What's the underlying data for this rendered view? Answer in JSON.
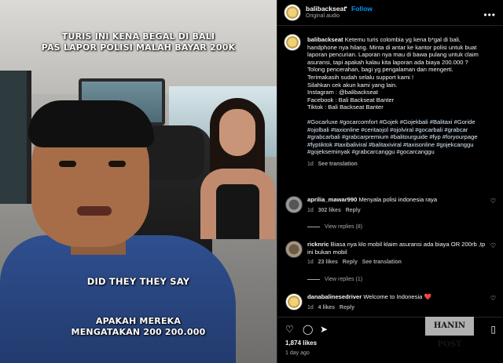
{
  "video": {
    "caption_top": "TURIS INI KENA BEGAL DI BALI\nPAS LAPOR POLISI MALAH BAYAR 200K",
    "caption_mid": "DID THEY THEY SAY",
    "caption_bottom": "APAKAH MEREKA\nMENGATAKAN 200 200.000"
  },
  "header": {
    "username": "balibackseat",
    "follow_label": "Follow",
    "audio": "Original audio",
    "more_icon": "more-horizontal-icon"
  },
  "post": {
    "username": "balibackseat",
    "lines": [
      "Ketemu turis colombia yg kena b*gal di bali,",
      "handphone nya hilang. Minta di antar ke kantor polisi untuk buat",
      "laporan pencurian. Laporan nya mau di bawa pulang untuk claim",
      "asuransi, tapi apakah kalau kita laporan ada biaya 200.000 ?",
      "Tolong pencerahan, bagi yg pengalaman dan mengerti.",
      "Terimakasih sudah selalu support kami !",
      "Silahkan cek akun kami yang lain.",
      "Instagram : @balibackseat",
      "Facebook : Bali Backseat Banter",
      "Tiktok : Bali Backseat Banter"
    ],
    "hashtags": "#Gocarluxe #gocarcomfort #Gojek #Gojekbali #Balitaxi #Goride #ojolbali #taxionline #ceritaojol #ojolviral #gocarbali #grabcar #grabcarbali #grabcarpremium #balitourguide #fyp #foryourpage #fyptiktok #taxibaliviral #balitaxiviral #taxisonline #gojekcanggu #gojekseminyak #grabcarcanggu #gocarcanggu",
    "time": "1d",
    "see_translation": "See translation"
  },
  "comments": [
    {
      "username": "aprilia_mawar990",
      "text": "Menyala polisi indonesia raya",
      "time": "1d",
      "likes": "302 likes",
      "reply_label": "Reply",
      "view_replies": "View replies (8)"
    },
    {
      "username": "ricknric",
      "text": "Biasa nya klo mobil klaim asuransi ada biaya OR 200rb ,tp ini bukan mobil",
      "time": "1d",
      "likes": "23 likes",
      "reply_label": "Reply",
      "see_translation": "See translation",
      "view_replies": "View replies (1)"
    },
    {
      "username": "danabalinesedriver",
      "text": "Welcome to Indonesia ❤️",
      "time": "1d",
      "likes": "4 likes",
      "reply_label": "Reply"
    }
  ],
  "footer": {
    "likes": "1,874 likes",
    "ago": "1 day ago",
    "watermark": "HANIN POST"
  },
  "icons": {
    "like": "heart-icon",
    "comment": "comment-icon",
    "share": "share-icon",
    "save": "bookmark-icon"
  }
}
